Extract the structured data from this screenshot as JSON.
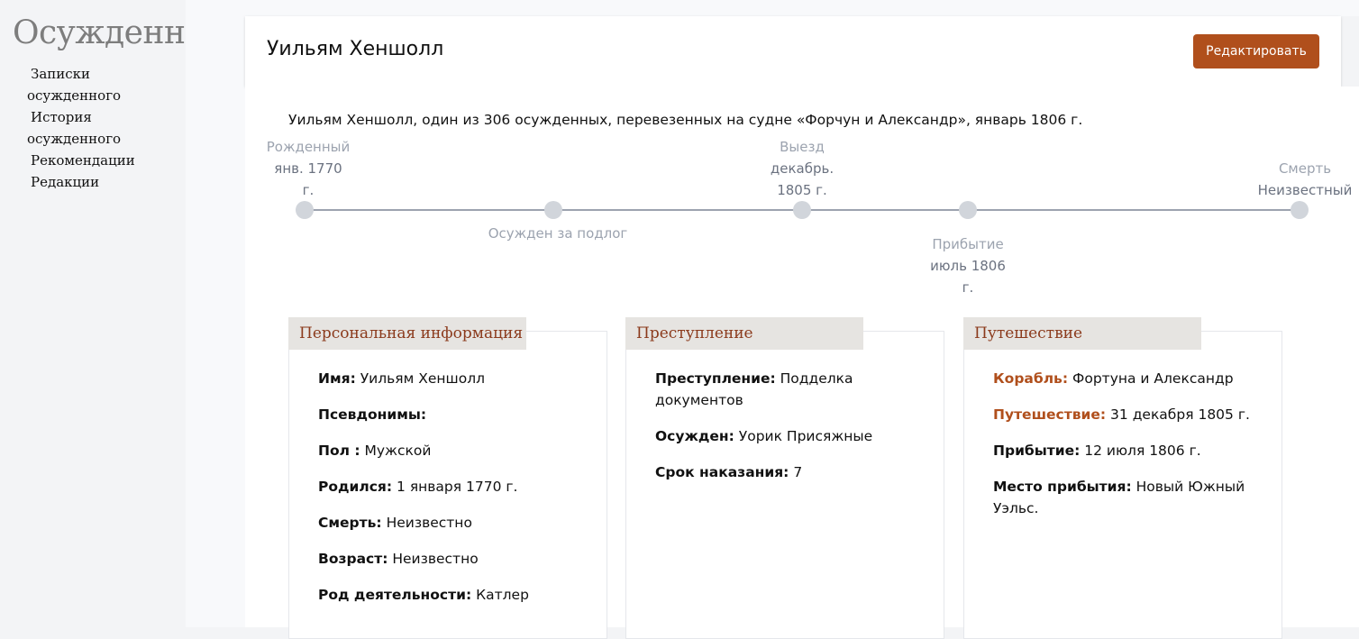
{
  "sidebar": {
    "logo": "Осужденный",
    "items": [
      {
        "label": "Записки осужденного"
      },
      {
        "label": "История осужденного"
      },
      {
        "label": "Рекомендации"
      },
      {
        "label": "Редакции"
      }
    ]
  },
  "header": {
    "title": "Уильям Хеншолл",
    "edit_label": "Редактировать"
  },
  "summary": "Уильям Хеншолл, один из 306 осужденных, перевезенных на судне «Форчун и Александр», январь 1806 г.",
  "timeline": {
    "born": {
      "label": "Рожденный",
      "value": "янв. 1770 г."
    },
    "convicted": {
      "label": "Осужден за подлог"
    },
    "departure": {
      "label": "Выезд",
      "value": "декабрь. 1805 г."
    },
    "arrival": {
      "label": "Прибытие",
      "value": "июль 1806 г."
    },
    "death": {
      "label": "Смерть",
      "value": "Неизвестный"
    }
  },
  "personal": {
    "heading": "Персональная информация",
    "fields": [
      {
        "k": "Имя:",
        "v": "Уильям Хеншолл"
      },
      {
        "k": "Псевдонимы:",
        "v": ""
      },
      {
        "k": "Пол :",
        "v": "Мужской"
      },
      {
        "k": "Родился:",
        "v": "1 января 1770 г."
      },
      {
        "k": "Смерть:",
        "v": "Неизвестно"
      },
      {
        "k": "Возраст:",
        "v": "Неизвестно"
      },
      {
        "k": "Род деятельности:",
        "v": "Катлер"
      }
    ]
  },
  "crime": {
    "heading": "Преступление",
    "fields": [
      {
        "k": "Преступление:",
        "v": "Подделка документов"
      },
      {
        "k": "Осужден:",
        "v": "Уорик Присяжные"
      },
      {
        "k": "Срок наказания:",
        "v": "7"
      }
    ]
  },
  "voyage": {
    "heading": "Путешествие",
    "fields": [
      {
        "k": "Корабль:",
        "v": "Фортуна и Александр"
      },
      {
        "k": "Путешествие:",
        "v": "31 декабря 1805 г."
      },
      {
        "k": "Прибытие:",
        "v": "12 июля 1806 г."
      },
      {
        "k": "Место прибытия:",
        "v": "Новый Южный Уэльс."
      }
    ]
  },
  "colors": {
    "accent": "#b04f1c",
    "tab_bg": "#e6e4e1",
    "heading": "#8b3a1c"
  }
}
